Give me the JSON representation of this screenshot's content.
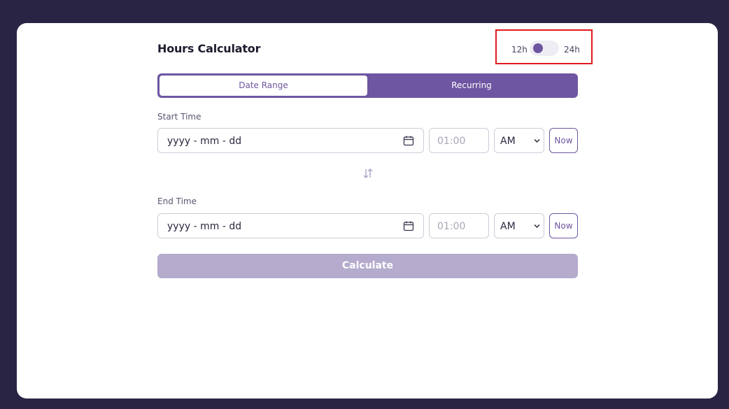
{
  "header": {
    "title": "Hours Calculator",
    "toggle": {
      "left_label": "12h",
      "right_label": "24h",
      "state": "12h"
    }
  },
  "tabs": [
    {
      "label": "Date Range",
      "active": true
    },
    {
      "label": "Recurring",
      "active": false
    }
  ],
  "start": {
    "label": "Start Time",
    "date_placeholder": "yyyy - mm - dd",
    "time_placeholder": "01:00",
    "ampm": "AM",
    "now_label": "Now"
  },
  "end": {
    "label": "End Time",
    "date_placeholder": "yyyy - mm - dd",
    "time_placeholder": "01:00",
    "ampm": "AM",
    "now_label": "Now"
  },
  "calculate_label": "Calculate",
  "colors": {
    "accent": "#6e56a2",
    "button_disabled": "#b5abcd",
    "background": "#2a2444",
    "highlight_box": "#e0191e"
  },
  "icons": [
    "calendar-icon",
    "swap-vertical-icon",
    "chevron-down-icon"
  ]
}
